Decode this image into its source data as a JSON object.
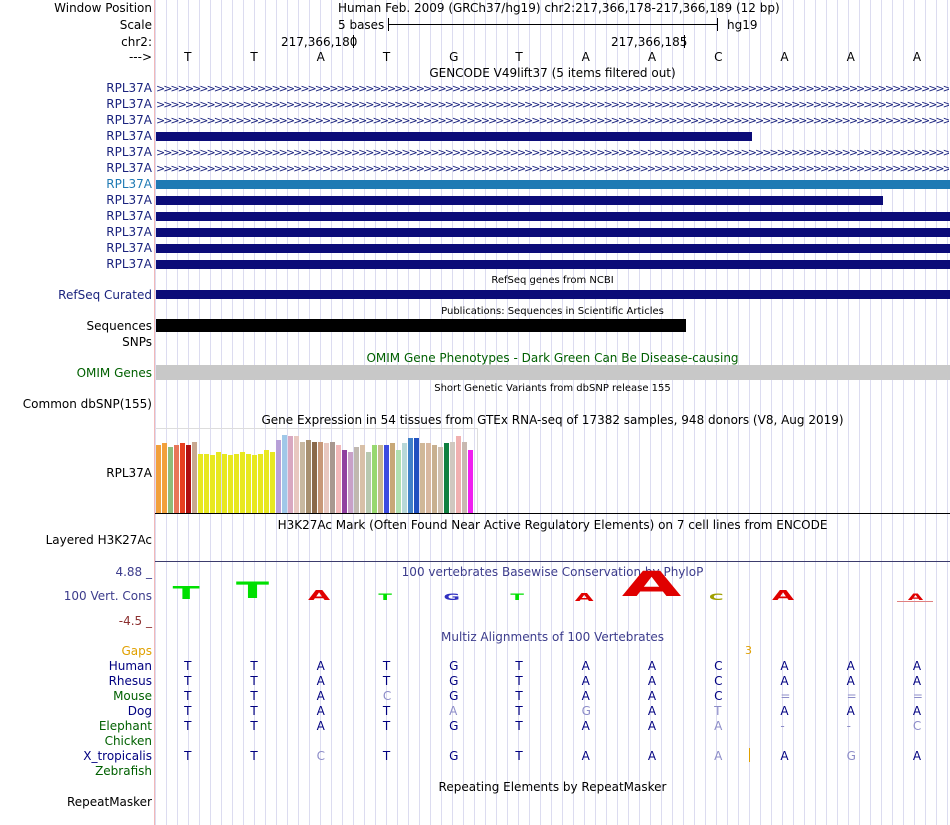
{
  "header": {
    "window_position_label": "Window Position",
    "scale_label": "Scale",
    "chr_label": "chr2:",
    "strand_label": "--->",
    "assembly_title": "Human Feb. 2009 (GRCh37/hg19)   chr2:217,366,178-217,366,189 (12 bp)",
    "scale_text": "5 bases",
    "scale_db": "hg19",
    "pos1": "217,366,180",
    "pos2": "217,366,185"
  },
  "bases": [
    "T",
    "T",
    "A",
    "T",
    "G",
    "T",
    "A",
    "A",
    "C",
    "A",
    "A",
    "A"
  ],
  "gencode": {
    "title": "GENCODE V49lift37 (5 items filtered out)",
    "rows": [
      {
        "label": "RPL37A",
        "style": "arrows",
        "highlight": false
      },
      {
        "label": "RPL37A",
        "style": "arrows",
        "highlight": false
      },
      {
        "label": "RPL37A",
        "style": "arrows",
        "highlight": false
      },
      {
        "label": "RPL37A",
        "style": "bar",
        "end": 0.75,
        "highlight": false
      },
      {
        "label": "RPL37A",
        "style": "arrows",
        "highlight": false
      },
      {
        "label": "RPL37A",
        "style": "arrows",
        "highlight": false
      },
      {
        "label": "RPL37A",
        "style": "bar",
        "end": 1.0,
        "highlight": true
      },
      {
        "label": "RPL37A",
        "style": "bar",
        "end": 0.915,
        "highlight": false
      },
      {
        "label": "RPL37A",
        "style": "bar",
        "end": 1.0,
        "highlight": false
      },
      {
        "label": "RPL37A",
        "style": "bar",
        "end": 1.0,
        "highlight": false
      },
      {
        "label": "RPL37A",
        "style": "bar",
        "end": 1.0,
        "highlight": false
      },
      {
        "label": "RPL37A",
        "style": "bar",
        "end": 1.0,
        "highlight": false
      }
    ]
  },
  "refseq": {
    "title": "RefSeq genes from NCBI",
    "label": "RefSeq Curated"
  },
  "publications": {
    "title": "Publications: Sequences in Scientific Articles",
    "label": "Sequences",
    "bar_end": 0.667
  },
  "snps_label": "SNPs",
  "omim": {
    "title": "OMIM Gene Phenotypes - Dark Green Can Be Disease-causing",
    "label": "OMIM Genes"
  },
  "dbsnp": {
    "title": "Short Genetic Variants from dbSNP release 155",
    "label": "Common dbSNP(155)"
  },
  "gtex": {
    "title": "Gene Expression in 54 tissues from GTEx RNA-seq of 17382 samples, 948 donors (V8, Aug 2019)",
    "label": "RPL37A",
    "bars": [
      {
        "h": 0.8,
        "c": "#f2a03c"
      },
      {
        "h": 0.82,
        "c": "#f2a03c"
      },
      {
        "h": 0.78,
        "c": "#8fbc7a"
      },
      {
        "h": 0.8,
        "c": "#e8765a"
      },
      {
        "h": 0.82,
        "c": "#e84020"
      },
      {
        "h": 0.8,
        "c": "#b01010"
      },
      {
        "h": 0.84,
        "c": "#c8a890"
      },
      {
        "h": 0.7,
        "c": "#e8e820"
      },
      {
        "h": 0.7,
        "c": "#e8e820"
      },
      {
        "h": 0.68,
        "c": "#e8e820"
      },
      {
        "h": 0.72,
        "c": "#e8e820"
      },
      {
        "h": 0.7,
        "c": "#e8e820"
      },
      {
        "h": 0.68,
        "c": "#e8e820"
      },
      {
        "h": 0.7,
        "c": "#e8e820"
      },
      {
        "h": 0.72,
        "c": "#e8e820"
      },
      {
        "h": 0.7,
        "c": "#e8e820"
      },
      {
        "h": 0.68,
        "c": "#e8e820"
      },
      {
        "h": 0.7,
        "c": "#e8e820"
      },
      {
        "h": 0.74,
        "c": "#e8e820"
      },
      {
        "h": 0.72,
        "c": "#e8e820"
      },
      {
        "h": 0.86,
        "c": "#b8a0d8"
      },
      {
        "h": 0.92,
        "c": "#a0c8e8"
      },
      {
        "h": 0.9,
        "c": "#d8a8c0"
      },
      {
        "h": 0.9,
        "c": "#e8c8c0"
      },
      {
        "h": 0.84,
        "c": "#c8b8a0"
      },
      {
        "h": 0.86,
        "c": "#a89070"
      },
      {
        "h": 0.84,
        "c": "#8b6a4a"
      },
      {
        "h": 0.84,
        "c": "#c89878"
      },
      {
        "h": 0.82,
        "c": "#e8c8c0"
      },
      {
        "h": 0.84,
        "c": "#a89890"
      },
      {
        "h": 0.8,
        "c": "#f2b8b8"
      },
      {
        "h": 0.74,
        "c": "#9040a0"
      },
      {
        "h": 0.72,
        "c": "#c8a0c8"
      },
      {
        "h": 0.78,
        "c": "#c0b8b0"
      },
      {
        "h": 0.8,
        "c": "#d8c0a8"
      },
      {
        "h": 0.72,
        "c": "#b8c8b0"
      },
      {
        "h": 0.8,
        "c": "#98d870"
      },
      {
        "h": 0.8,
        "c": "#c8b890"
      },
      {
        "h": 0.8,
        "c": "#3c4ce0"
      },
      {
        "h": 0.82,
        "c": "#c8a878"
      },
      {
        "h": 0.74,
        "c": "#b0e0b0"
      },
      {
        "h": 0.82,
        "c": "#b8d8d8"
      },
      {
        "h": 0.88,
        "c": "#4080c8"
      },
      {
        "h": 0.88,
        "c": "#2050c0"
      },
      {
        "h": 0.82,
        "c": "#d0b898"
      },
      {
        "h": 0.82,
        "c": "#d8b8a0"
      },
      {
        "h": 0.8,
        "c": "#c8b090"
      },
      {
        "h": 0.78,
        "c": "#d0c0b0"
      },
      {
        "h": 0.82,
        "c": "#108040"
      },
      {
        "h": 0.84,
        "c": "#d0c8c0"
      },
      {
        "h": 0.9,
        "c": "#f0b0b0"
      },
      {
        "h": 0.84,
        "c": "#c8b8b0"
      },
      {
        "h": 0.74,
        "c": "#f01ef0"
      }
    ]
  },
  "h3k27ac": {
    "title": "H3K27Ac Mark (Often Found Near Active Regulatory Elements) on 7 cell lines from ENCODE",
    "label": "Layered H3K27Ac"
  },
  "cons": {
    "title": "100 vertebrates Basewise Conservation by PhyloP",
    "label": "100 Vert. Cons",
    "ymax": "4.88 _",
    "ymin": "-4.5 _",
    "logo": [
      {
        "b": "T",
        "c": "#00e000",
        "v": 1.6
      },
      {
        "b": "T",
        "c": "#00e000",
        "v": 2.0
      },
      {
        "b": "A",
        "c": "#e00000",
        "v": -1.0
      },
      {
        "b": "T",
        "c": "#00e000",
        "v": 0.5
      },
      {
        "b": "G",
        "c": "#3030c0",
        "v": -0.15
      },
      {
        "b": "T",
        "c": "#00e000",
        "v": 0.5
      },
      {
        "b": "A",
        "c": "#e00000",
        "v": -0.8
      },
      {
        "b": "A",
        "c": "#e00000",
        "v": -3.5
      },
      {
        "b": "C",
        "c": "#a0a000",
        "v": 0.6
      },
      {
        "b": "A",
        "c": "#e00000",
        "v": -1.0
      },
      {
        "b": "",
        "c": "#e00000",
        "v": 0
      },
      {
        "b": "A",
        "c": "#e00000",
        "v": -0.15
      }
    ]
  },
  "multiz": {
    "title": "Multiz Alignments of 100 Vertebrates",
    "gaps_label": "Gaps",
    "gaps_value": "3",
    "species": [
      {
        "name": "Human",
        "color": "#000080",
        "seq": [
          "T",
          "T",
          "A",
          "T",
          "G",
          "T",
          "A",
          "A",
          "C",
          "A",
          "A",
          "A"
        ],
        "faint": []
      },
      {
        "name": "Rhesus",
        "color": "#000080",
        "seq": [
          "T",
          "T",
          "A",
          "T",
          "G",
          "T",
          "A",
          "A",
          "C",
          "A",
          "A",
          "A"
        ],
        "faint": []
      },
      {
        "name": "Mouse",
        "color": "#006000",
        "seq": [
          "T",
          "T",
          "A",
          "C",
          "G",
          "T",
          "A",
          "A",
          "C",
          "=",
          "=",
          "="
        ],
        "faint": [
          3,
          9,
          10,
          11
        ]
      },
      {
        "name": "Dog",
        "color": "#000080",
        "seq": [
          "T",
          "T",
          "A",
          "T",
          "A",
          "T",
          "G",
          "A",
          "T",
          "A",
          "A",
          "A"
        ],
        "faint": [
          4,
          6,
          8
        ]
      },
      {
        "name": "Elephant",
        "color": "#006000",
        "seq": [
          "T",
          "T",
          "A",
          "T",
          "G",
          "T",
          "A",
          "A",
          "A",
          "-",
          "-",
          "C"
        ],
        "faint": [
          8,
          9,
          10,
          11
        ]
      },
      {
        "name": "Chicken",
        "color": "#006000",
        "seq": [
          "",
          "",
          "",
          "",
          "",
          "",
          "",
          "",
          "",
          "",
          "",
          ""
        ],
        "faint": []
      },
      {
        "name": "X_tropicalis",
        "color": "#000080",
        "seq": [
          "T",
          "T",
          "C",
          "T",
          "G",
          "T",
          "A",
          "A",
          "A",
          "A",
          "G",
          "A"
        ],
        "faint": [
          2,
          8,
          10
        ]
      },
      {
        "name": "Zebrafish",
        "color": "#006000",
        "seq": [
          "",
          "",
          "",
          "",
          "",
          "",
          "",
          "",
          "",
          "",
          "",
          ""
        ],
        "faint": []
      }
    ]
  },
  "repeatmasker": {
    "title": "Repeating Elements by RepeatMasker",
    "label": "RepeatMasker"
  },
  "colors": {
    "gene_navy": "#0c0c78",
    "gene_highlight": "#1f7ab4",
    "omim_gray": "#c8c8c8",
    "label_blue": "#1a237e",
    "omim_green": "#006000",
    "cons_blue": "#3c3c8c",
    "gaps_orange": "#e0a000"
  }
}
